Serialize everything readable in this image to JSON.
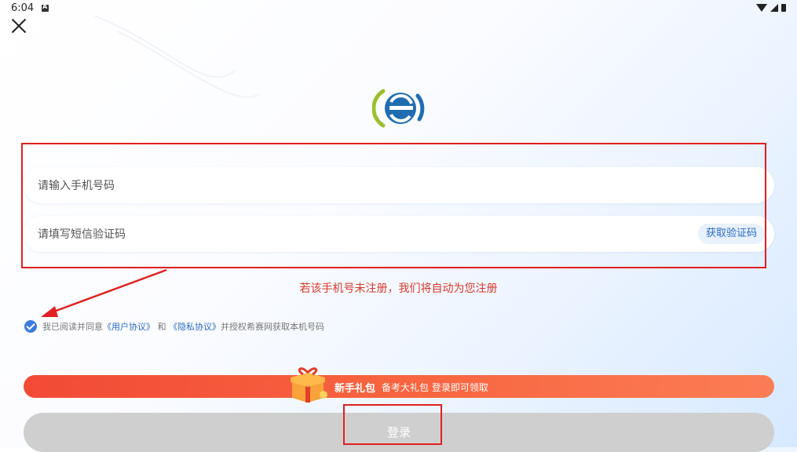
{
  "status_bar": {
    "time": "6:04"
  },
  "form": {
    "phone_placeholder": "请输入手机号码",
    "code_placeholder": "请填写短信验证码",
    "get_code_label": "获取验证码",
    "auto_register_note": "若该手机号未注册，我们将自动为您注册"
  },
  "agreement": {
    "prefix": "我已阅读并同意",
    "user_agreement": "《用户协议》",
    "and": "和",
    "privacy_agreement": "《隐私协议》",
    "suffix": "并授权希赛网获取本机号码",
    "checked": true
  },
  "gift": {
    "title": "新手礼包",
    "subtitle": "备考大礼包 登录即可领取"
  },
  "login_label": "登录",
  "colors": {
    "accent_blue": "#2a6bc4",
    "annotation_red": "#e02020",
    "note_red": "#d93a2b",
    "banner_orange": "#f7643f"
  }
}
